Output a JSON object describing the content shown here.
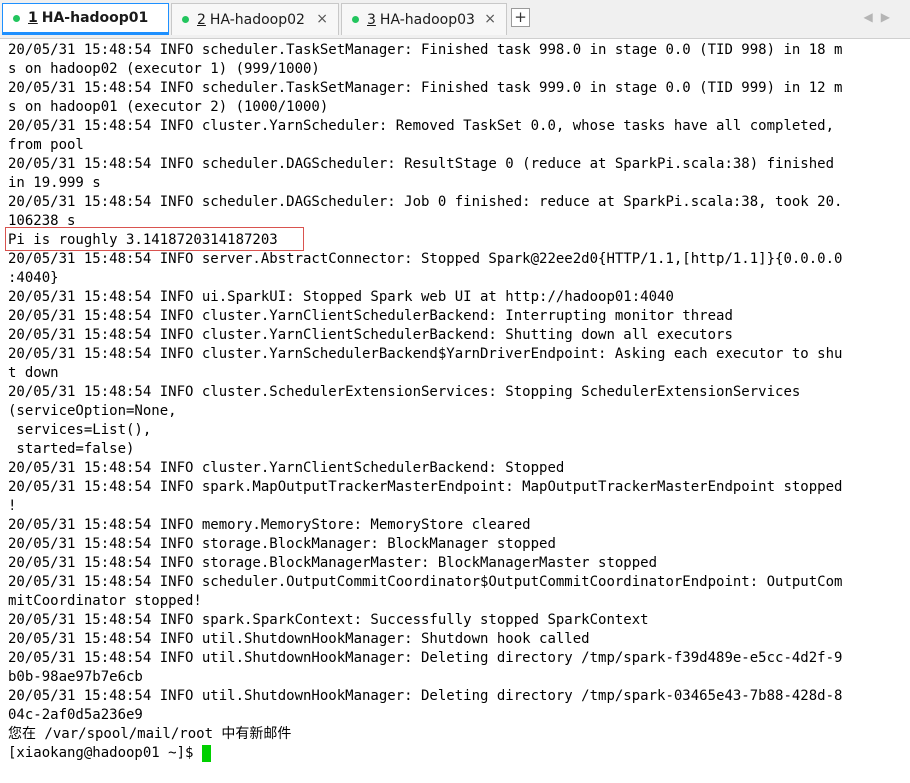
{
  "tabs": [
    {
      "number": "1",
      "label": "HA-hadoop01",
      "active": true,
      "close": "×"
    },
    {
      "number": "2",
      "label": "HA-hadoop02",
      "active": false,
      "close": "×"
    },
    {
      "number": "3",
      "label": "HA-hadoop03",
      "active": false,
      "close": "×"
    }
  ],
  "add_tab": "+",
  "nav": {
    "prev": "◀",
    "next": "▶"
  },
  "colors": {
    "active_tab_accent": "#1e90ff",
    "status_dot": "#22c55e",
    "highlight_box": "#d9534f",
    "cursor": "#00d000"
  },
  "terminal": {
    "lines": [
      "20/05/31 15:48:54 INFO scheduler.TaskSetManager: Finished task 998.0 in stage 0.0 (TID 998) in 18 m",
      "s on hadoop02 (executor 1) (999/1000)",
      "20/05/31 15:48:54 INFO scheduler.TaskSetManager: Finished task 999.0 in stage 0.0 (TID 999) in 12 m",
      "s on hadoop01 (executor 2) (1000/1000)",
      "20/05/31 15:48:54 INFO cluster.YarnScheduler: Removed TaskSet 0.0, whose tasks have all completed,",
      "from pool",
      "20/05/31 15:48:54 INFO scheduler.DAGScheduler: ResultStage 0 (reduce at SparkPi.scala:38) finished",
      "in 19.999 s",
      "20/05/31 15:48:54 INFO scheduler.DAGScheduler: Job 0 finished: reduce at SparkPi.scala:38, took 20.",
      "106238 s",
      "Pi is roughly 3.1418720314187203",
      "20/05/31 15:48:54 INFO server.AbstractConnector: Stopped Spark@22ee2d0{HTTP/1.1,[http/1.1]}{0.0.0.0",
      ":4040}",
      "20/05/31 15:48:54 INFO ui.SparkUI: Stopped Spark web UI at http://hadoop01:4040",
      "20/05/31 15:48:54 INFO cluster.YarnClientSchedulerBackend: Interrupting monitor thread",
      "20/05/31 15:48:54 INFO cluster.YarnClientSchedulerBackend: Shutting down all executors",
      "20/05/31 15:48:54 INFO cluster.YarnSchedulerBackend$YarnDriverEndpoint: Asking each executor to shu",
      "t down",
      "20/05/31 15:48:54 INFO cluster.SchedulerExtensionServices: Stopping SchedulerExtensionServices",
      "(serviceOption=None,",
      " services=List(),",
      " started=false)",
      "20/05/31 15:48:54 INFO cluster.YarnClientSchedulerBackend: Stopped",
      "20/05/31 15:48:54 INFO spark.MapOutputTrackerMasterEndpoint: MapOutputTrackerMasterEndpoint stopped",
      "!",
      "20/05/31 15:48:54 INFO memory.MemoryStore: MemoryStore cleared",
      "20/05/31 15:48:54 INFO storage.BlockManager: BlockManager stopped",
      "20/05/31 15:48:54 INFO storage.BlockManagerMaster: BlockManagerMaster stopped",
      "20/05/31 15:48:54 INFO scheduler.OutputCommitCoordinator$OutputCommitCoordinatorEndpoint: OutputCom",
      "mitCoordinator stopped!",
      "20/05/31 15:48:54 INFO spark.SparkContext: Successfully stopped SparkContext",
      "20/05/31 15:48:54 INFO util.ShutdownHookManager: Shutdown hook called",
      "20/05/31 15:48:54 INFO util.ShutdownHookManager: Deleting directory /tmp/spark-f39d489e-e5cc-4d2f-9",
      "b0b-98ae97b7e6cb",
      "20/05/31 15:48:54 INFO util.ShutdownHookManager: Deleting directory /tmp/spark-03465e43-7b88-428d-8",
      "04c-2af0d5a236e9",
      "您在 /var/spool/mail/root 中有新邮件"
    ],
    "prompt": "[xiaokang@hadoop01 ~]$"
  }
}
